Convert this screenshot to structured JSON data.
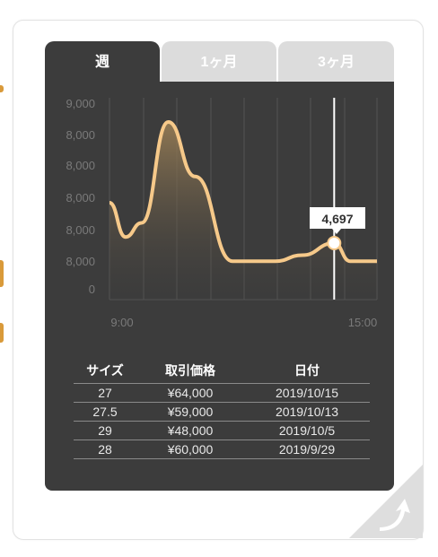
{
  "tabs": [
    {
      "label": "週",
      "active": true
    },
    {
      "label": "1ヶ月",
      "active": false
    },
    {
      "label": "3ヶ月",
      "active": false
    }
  ],
  "chart_data": {
    "type": "area",
    "y_tick_labels": [
      "9,000",
      "8,000",
      "8,000",
      "8,000",
      "8,000",
      "8,000",
      "0"
    ],
    "x_tick_labels": [
      "9:00",
      "15:00"
    ],
    "x": [
      0,
      0.06,
      0.12,
      0.22,
      0.32,
      0.46,
      0.62,
      0.72,
      0.84,
      0.9,
      1.0
    ],
    "y": [
      0.48,
      0.31,
      0.38,
      0.88,
      0.61,
      0.19,
      0.19,
      0.22,
      0.28,
      0.19,
      0.19
    ],
    "highlight_label": "4,697",
    "line_color": "#f6c98a",
    "fill_color": "#9a7f56",
    "grid": true
  },
  "table": {
    "headers": [
      "サイズ",
      "取引価格",
      "日付"
    ],
    "rows": [
      [
        "27",
        "¥64,000",
        "2019/10/15"
      ],
      [
        "27.5",
        "¥59,000",
        "2019/10/13"
      ],
      [
        "29",
        "¥48,000",
        "2019/10/5"
      ],
      [
        "28",
        "¥60,000",
        "2019/9/29"
      ]
    ]
  },
  "colors": {
    "panel": "#3c3c3c",
    "tab_inactive": "#dcdcdc",
    "accent": "#d99a3a"
  },
  "corner_icon": "share-arrow-icon"
}
